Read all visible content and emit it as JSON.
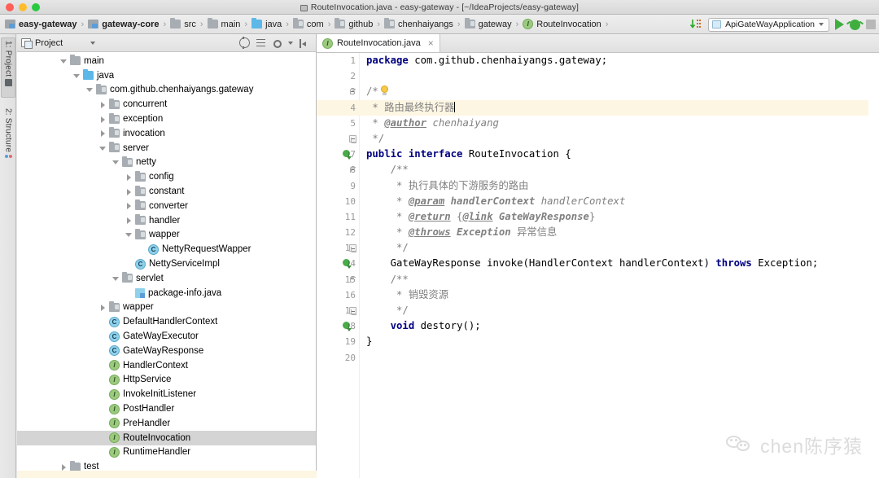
{
  "window": {
    "title": "RouteInvocation.java - easy-gateway - [~/IdeaProjects/easy-gateway]",
    "doc_icon": "document-icon"
  },
  "breadcrumb": {
    "items": [
      {
        "label": "easy-gateway",
        "icon": "module-icon",
        "bold": true
      },
      {
        "label": "gateway-core",
        "icon": "module-icon",
        "bold": true
      },
      {
        "label": "src",
        "icon": "folder-icon",
        "bold": false
      },
      {
        "label": "main",
        "icon": "folder-icon",
        "bold": false
      },
      {
        "label": "java",
        "icon": "source-folder-icon",
        "bold": false
      },
      {
        "label": "com",
        "icon": "package-icon",
        "bold": false
      },
      {
        "label": "github",
        "icon": "package-icon",
        "bold": false
      },
      {
        "label": "chenhaiyangs",
        "icon": "package-icon",
        "bold": false
      },
      {
        "label": "gateway",
        "icon": "package-icon",
        "bold": false
      },
      {
        "label": "RouteInvocation",
        "icon": "interface-icon",
        "bold": false
      }
    ],
    "separator": "›"
  },
  "toolbar": {
    "run_configuration": "ApiGateWayApplication",
    "dropdown_caret": "chevron-down-icon",
    "run_label": "Run",
    "debug_label": "Debug",
    "stop_label": "Stop",
    "updown_label": "Update"
  },
  "tool_windows": {
    "left": [
      {
        "label": "1: Project",
        "icon": "project-icon",
        "selected": true
      },
      {
        "label": "2: Structure",
        "icon": "structure-icon",
        "selected": false
      }
    ]
  },
  "project_panel": {
    "title": "Project",
    "title_caret": "chevron-down-icon",
    "tools": [
      {
        "name": "collapse-all-icon"
      },
      {
        "name": "expand-all-icon"
      },
      {
        "name": "settings-gear-icon"
      },
      {
        "name": "hide-panel-icon"
      }
    ],
    "tree": [
      {
        "label": "main",
        "indent": 3,
        "icon": "folder-icon",
        "twisty": "open",
        "selected": false
      },
      {
        "label": "java",
        "indent": 4,
        "icon": "source-folder-icon",
        "twisty": "open",
        "selected": false
      },
      {
        "label": "com.github.chenhaiyangs.gateway",
        "indent": 5,
        "icon": "package-icon",
        "twisty": "open",
        "selected": false
      },
      {
        "label": "concurrent",
        "indent": 6,
        "icon": "package-icon",
        "twisty": "closed",
        "selected": false
      },
      {
        "label": "exception",
        "indent": 6,
        "icon": "package-icon",
        "twisty": "closed",
        "selected": false
      },
      {
        "label": "invocation",
        "indent": 6,
        "icon": "package-icon",
        "twisty": "closed",
        "selected": false
      },
      {
        "label": "server",
        "indent": 6,
        "icon": "package-icon",
        "twisty": "open",
        "selected": false
      },
      {
        "label": "netty",
        "indent": 7,
        "icon": "package-icon",
        "twisty": "open",
        "selected": false
      },
      {
        "label": "config",
        "indent": 8,
        "icon": "package-icon",
        "twisty": "closed",
        "selected": false
      },
      {
        "label": "constant",
        "indent": 8,
        "icon": "package-icon",
        "twisty": "closed",
        "selected": false
      },
      {
        "label": "converter",
        "indent": 8,
        "icon": "package-icon",
        "twisty": "closed",
        "selected": false
      },
      {
        "label": "handler",
        "indent": 8,
        "icon": "package-icon",
        "twisty": "closed",
        "selected": false
      },
      {
        "label": "wapper",
        "indent": 8,
        "icon": "package-icon",
        "twisty": "open",
        "selected": false
      },
      {
        "label": "NettyRequestWapper",
        "indent": 9,
        "icon": "class-icon",
        "twisty": "none",
        "selected": false
      },
      {
        "label": "NettyServiceImpl",
        "indent": 8,
        "icon": "class-icon",
        "twisty": "none",
        "selected": false
      },
      {
        "label": "servlet",
        "indent": 7,
        "icon": "package-icon",
        "twisty": "open",
        "selected": false
      },
      {
        "label": "package-info.java",
        "indent": 8,
        "icon": "java-file-icon",
        "twisty": "none",
        "selected": false
      },
      {
        "label": "wapper",
        "indent": 6,
        "icon": "package-icon",
        "twisty": "closed",
        "selected": false
      },
      {
        "label": "DefaultHandlerContext",
        "indent": 6,
        "icon": "class-icon",
        "twisty": "none",
        "selected": false
      },
      {
        "label": "GateWayExecutor",
        "indent": 6,
        "icon": "class-icon",
        "twisty": "none",
        "selected": false
      },
      {
        "label": "GateWayResponse",
        "indent": 6,
        "icon": "class-icon",
        "twisty": "none",
        "selected": false
      },
      {
        "label": "HandlerContext",
        "indent": 6,
        "icon": "interface-icon",
        "twisty": "none",
        "selected": false
      },
      {
        "label": "HttpService",
        "indent": 6,
        "icon": "interface-icon",
        "twisty": "none",
        "selected": false
      },
      {
        "label": "InvokeInitListener",
        "indent": 6,
        "icon": "interface-icon",
        "twisty": "none",
        "selected": false
      },
      {
        "label": "PostHandler",
        "indent": 6,
        "icon": "interface-icon",
        "twisty": "none",
        "selected": false
      },
      {
        "label": "PreHandler",
        "indent": 6,
        "icon": "interface-icon",
        "twisty": "none",
        "selected": false
      },
      {
        "label": "RouteInvocation",
        "indent": 6,
        "icon": "interface-icon",
        "twisty": "none",
        "selected": true
      },
      {
        "label": "RuntimeHandler",
        "indent": 6,
        "icon": "interface-icon",
        "twisty": "none",
        "selected": false
      },
      {
        "label": "test",
        "indent": 3,
        "icon": "folder-icon",
        "twisty": "closed",
        "selected": false
      }
    ]
  },
  "editor": {
    "tab": {
      "label": "RouteInvocation.java",
      "icon": "interface-icon",
      "close": "×"
    },
    "line_numbers": [
      "1",
      "2",
      "3",
      "4",
      "5",
      "6",
      "7",
      "8",
      "9",
      "10",
      "11",
      "12",
      "13",
      "14",
      "15",
      "16",
      "17",
      "18",
      "19",
      "20"
    ],
    "caret_line": 4,
    "lines": [
      {
        "n": 1,
        "text": "package com.github.chenhaiyangs.gateway;"
      },
      {
        "n": 2,
        "text": ""
      },
      {
        "n": 3,
        "text": "/**"
      },
      {
        "n": 4,
        "text": " * 路由最终执行器"
      },
      {
        "n": 5,
        "text": " * @author chenhaiyang"
      },
      {
        "n": 6,
        "text": " */"
      },
      {
        "n": 7,
        "text": "public interface RouteInvocation {"
      },
      {
        "n": 8,
        "text": "    /**"
      },
      {
        "n": 9,
        "text": "     * 执行具体的下游服务的路由"
      },
      {
        "n": 10,
        "text": "     * @param handlerContext handlerContext"
      },
      {
        "n": 11,
        "text": "     * @return {@link GateWayResponse}"
      },
      {
        "n": 12,
        "text": "     * @throws Exception 异常信息"
      },
      {
        "n": 13,
        "text": "     */"
      },
      {
        "n": 14,
        "text": "    GateWayResponse invoke(HandlerContext handlerContext) throws Exception;"
      },
      {
        "n": 15,
        "text": "    /**"
      },
      {
        "n": 16,
        "text": "     * 销毁资源"
      },
      {
        "n": 17,
        "text": "     */"
      },
      {
        "n": 18,
        "text": "    void destory();"
      },
      {
        "n": 19,
        "text": "}"
      },
      {
        "n": 20,
        "text": ""
      }
    ],
    "gutter_markers": [
      {
        "line": 3,
        "type": "intention-bulb-icon"
      },
      {
        "line": 7,
        "type": "run-gutter-icon"
      },
      {
        "line": 14,
        "type": "run-gutter-icon"
      },
      {
        "line": 18,
        "type": "run-gutter-icon"
      }
    ]
  },
  "watermark": {
    "icon": "wechat-icon",
    "text": "chen陈序猿"
  },
  "colors": {
    "accent": "#4a88c7",
    "run_green": "#3fae3f",
    "caret_line": "#fdf6e3",
    "selection": "#d4d4d4",
    "keyword": "#000080",
    "comment": "#808080"
  }
}
